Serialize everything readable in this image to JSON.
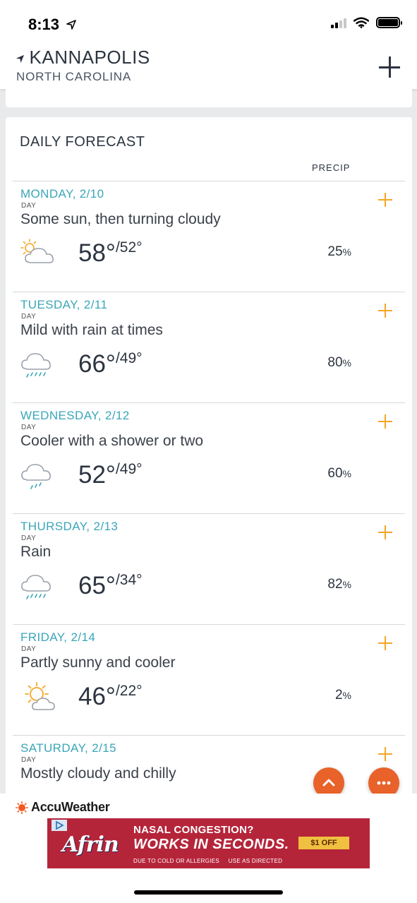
{
  "status": {
    "time": "8:13"
  },
  "header": {
    "city": "KANNAPOLIS",
    "state": "NORTH CAROLINA"
  },
  "forecast": {
    "title": "DAILY FORECAST",
    "precip_header": "PRECIP",
    "days": [
      {
        "date": "MONDAY, 2/10",
        "period": "DAY",
        "phrase": "Some sun, then turning cloudy",
        "hi": "58°",
        "lo": "/52°",
        "precip": "25",
        "icon": "partly-sunny-cloud-icon"
      },
      {
        "date": "TUESDAY, 2/11",
        "period": "DAY",
        "phrase": "Mild with rain at times",
        "hi": "66°",
        "lo": "/49°",
        "precip": "80",
        "icon": "rain-cloud-icon"
      },
      {
        "date": "WEDNESDAY, 2/12",
        "period": "DAY",
        "phrase": "Cooler with a shower or two",
        "hi": "52°",
        "lo": "/49°",
        "precip": "60",
        "icon": "shower-cloud-icon"
      },
      {
        "date": "THURSDAY, 2/13",
        "period": "DAY",
        "phrase": "Rain",
        "hi": "65°",
        "lo": "/34°",
        "precip": "82",
        "icon": "rain-cloud-icon"
      },
      {
        "date": "FRIDAY, 2/14",
        "period": "DAY",
        "phrase": "Partly sunny and cooler",
        "hi": "46°",
        "lo": "/22°",
        "precip": "2",
        "icon": "sun-behind-cloud-icon"
      },
      {
        "date": "SATURDAY, 2/15",
        "period": "DAY",
        "phrase": "Mostly cloudy and chilly"
      }
    ],
    "pct_symbol": "%"
  },
  "footer": {
    "brand": "AccuWeather"
  },
  "ad": {
    "brand": "Afrin",
    "line1": "NASAL CONGESTION?",
    "line2": "WORKS IN SECONDS.",
    "fine_print": "DUE TO COLD OR ALLERGIES     USE AS DIRECTED",
    "offer": "$1 OFF"
  },
  "colors": {
    "accent": "#f5a623",
    "date": "#3aa6b9",
    "fab": "#e8622a",
    "ad_bg": "#b5253a"
  }
}
